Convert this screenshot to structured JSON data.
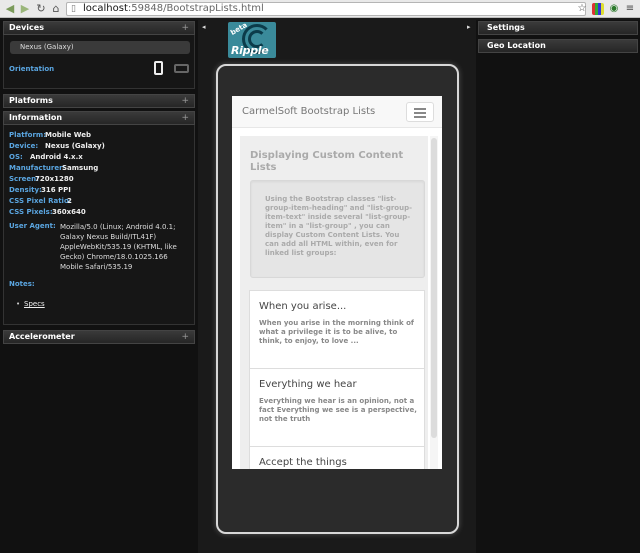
{
  "browser": {
    "url_host": "localhost",
    "url_path": ":59848/BootstrapLists.html",
    "icons": [
      "back-icon",
      "forward-icon",
      "reload-icon",
      "home-icon",
      "page-icon",
      "flag-icon",
      "extension-icon",
      "menu-icon"
    ]
  },
  "left_panel": {
    "devices": {
      "title": "Devices",
      "selected_device": "Nexus (Galaxy)",
      "orientation_label": "Orientation"
    },
    "platforms": {
      "title": "Platforms"
    },
    "information": {
      "title": "Information",
      "rows": [
        {
          "key": "Platform:",
          "value": "Mobile Web"
        },
        {
          "key": "Device:",
          "value": "Nexus (Galaxy)"
        },
        {
          "key": "OS:",
          "value": "Android 4.x.x"
        },
        {
          "key": "Manufacturer:",
          "value": "Samsung"
        },
        {
          "key": "Screen:",
          "value": "720x1280"
        },
        {
          "key": "Density:",
          "value": "316 PPI"
        },
        {
          "key": "CSS Pixel Ratio:",
          "value": "2"
        },
        {
          "key": "CSS Pixels:",
          "value": "360x640"
        }
      ],
      "user_agent_key": "User Agent:",
      "user_agent_value": "Mozilla/5.0 (Linux; Android 4.0.1; Galaxy Nexus Build/ITL41F) AppleWebKit/535.19 (KHTML, like Gecko) Chrome/18.0.1025.166 Mobile Safari/535.19",
      "notes_key": "Notes:",
      "specs_link": "Specs"
    },
    "accelerometer": {
      "title": "Accelerometer"
    },
    "plus": "+"
  },
  "ripple": {
    "beta": "beta",
    "name": "Ripple"
  },
  "app": {
    "brand": "CarmelSoft Bootstrap Lists",
    "heading": "Displaying Custom Content Lists",
    "well_text": "Using the Bootstrap classes \"list-group-item-heading\" and \"list-group-item-text\" inside several \"list-group-item\" in a \"list-group\" , you can display Custom Content Lists. You can add all HTML within, even for linked list groups:",
    "items": [
      {
        "heading": "When you arise...",
        "text": "When you arise in the morning think of what a privilege it is to be alive, to think, to enjoy, to love ..."
      },
      {
        "heading": "Everything we hear",
        "text": "Everything we hear is an opinion, not a fact Everything we see is a perspective, not the truth"
      },
      {
        "heading": "Accept the things",
        "text": ""
      }
    ]
  },
  "right_panel": {
    "settings": "Settings",
    "geo": "Geo Location"
  },
  "arrows": {
    "left": "◂",
    "right": "▸"
  }
}
